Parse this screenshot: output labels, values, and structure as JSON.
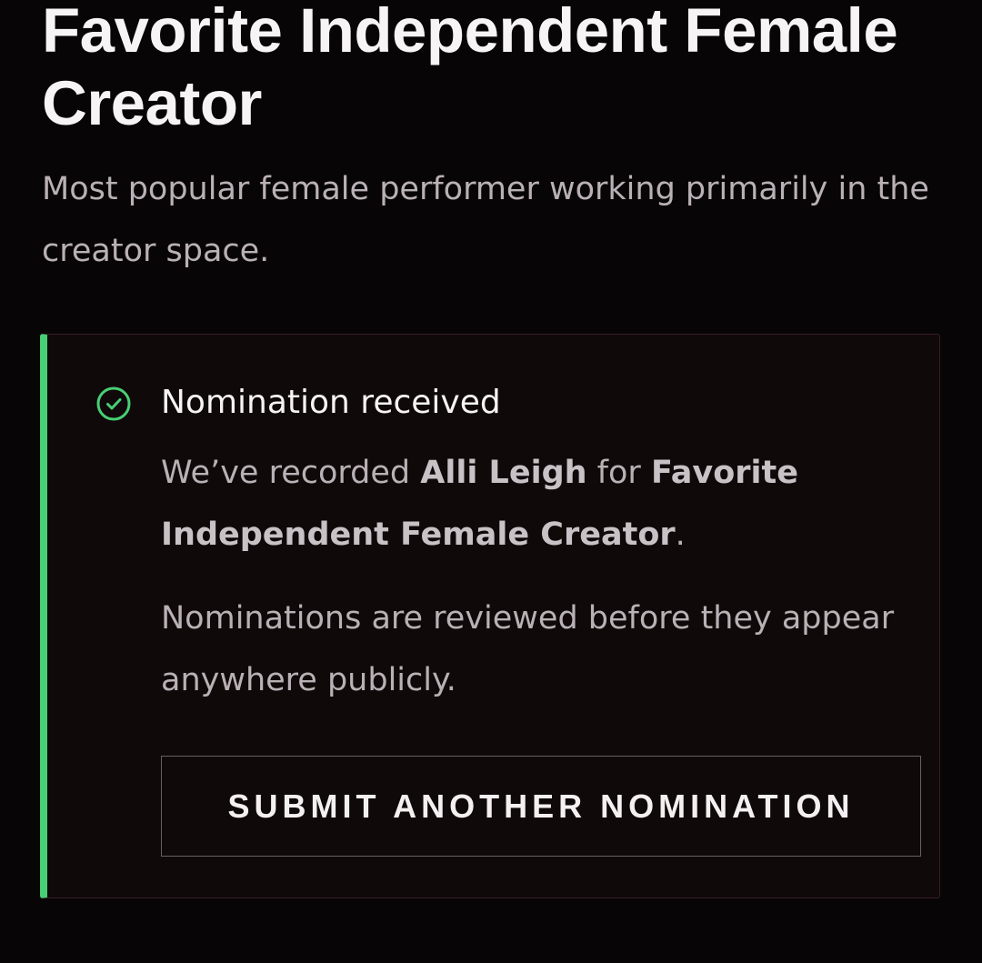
{
  "category": {
    "title": "Favorite Independent Female Creator",
    "description": "Most popular female performer working primarily in the creator space."
  },
  "confirmation": {
    "heading": "Nomination received",
    "message_prefix": "We’ve recorded ",
    "nominee": "Alli Leigh",
    "message_middle": " for ",
    "category_name": "Favorite Independent Female Creator",
    "message_suffix": ".",
    "note": "Nominations are reviewed before they appear anywhere publicly.",
    "button_label": "SUBMIT ANOTHER NOMINATION",
    "icon": "check-circle-icon"
  },
  "colors": {
    "background": "#070506",
    "card_background": "#0f090a",
    "accent_green": "#48cf74",
    "card_border": "#3a1e25",
    "muted_text": "#b9b1b5"
  }
}
